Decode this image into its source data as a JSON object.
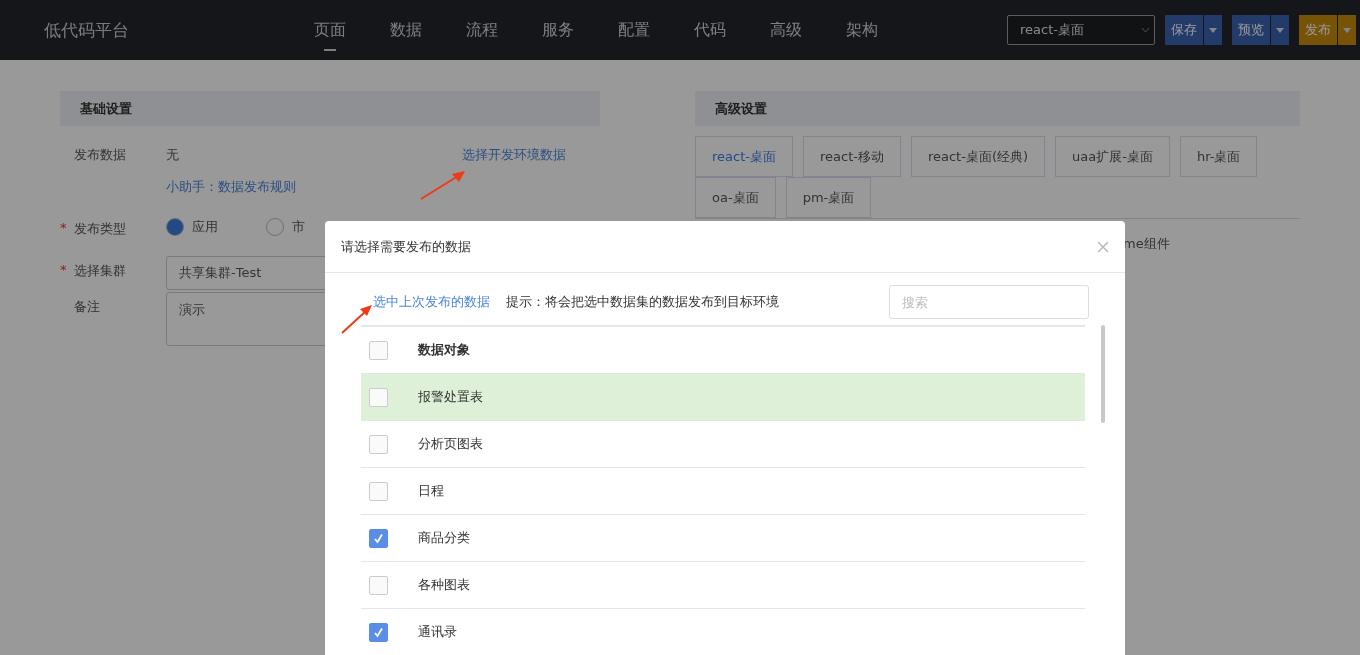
{
  "header": {
    "logo": "低代码平台",
    "nav": [
      {
        "label": "页面",
        "selected": true
      },
      {
        "label": "数据",
        "selected": false
      },
      {
        "label": "流程",
        "selected": false
      },
      {
        "label": "服务",
        "selected": false
      },
      {
        "label": "配置",
        "selected": false
      },
      {
        "label": "代码",
        "selected": false
      },
      {
        "label": "高级",
        "selected": false
      },
      {
        "label": "架构",
        "selected": false
      }
    ],
    "env_select": "react-桌面",
    "buttons": [
      {
        "label": "保存",
        "kind": "primary"
      },
      {
        "label": "预览",
        "kind": "primary"
      },
      {
        "label": "发布",
        "kind": "warning"
      }
    ]
  },
  "basic": {
    "title": "基础设置",
    "publish_data": {
      "label": "发布数据",
      "value": "无",
      "link": "选择开发环境数据",
      "help": "小助手：数据发布规则"
    },
    "publish_type": {
      "label": "发布类型",
      "required_mark": "*",
      "options": [
        {
          "label": "应用",
          "selected": true
        },
        {
          "label": "市",
          "selected": false
        }
      ]
    },
    "cluster": {
      "label": "选择集群",
      "required_mark": "*",
      "value": "共享集群-Test"
    },
    "remark": {
      "label": "备注",
      "value": "演示"
    }
  },
  "advanced": {
    "title": "高级设置",
    "tabs": [
      {
        "label": "react-桌面",
        "selected": true
      },
      {
        "label": "react-移动",
        "selected": false
      },
      {
        "label": "react-桌面(经典)",
        "selected": false
      },
      {
        "label": "uaa扩展-桌面",
        "selected": false
      },
      {
        "label": "hr-桌面",
        "selected": false
      },
      {
        "label": "oa-桌面",
        "selected": false
      },
      {
        "label": "pm-桌面",
        "selected": false
      }
    ],
    "option_text": "me组件"
  },
  "dialog": {
    "title": "请选择需要发布的数据",
    "link": "选中上次发布的数据",
    "hint": "提示：将会把选中数据集的数据发布到目标环境",
    "search": {
      "placeholder": "搜索"
    },
    "header": {
      "label": "数据对象",
      "checked": false
    },
    "rows": [
      {
        "name": "报警处置表",
        "checked": false,
        "selected": true
      },
      {
        "name": "分析页图表",
        "checked": false,
        "selected": false
      },
      {
        "name": "日程",
        "checked": false,
        "selected": false
      },
      {
        "name": "商品分类",
        "checked": true,
        "selected": false
      },
      {
        "name": "各种图表",
        "checked": false,
        "selected": false
      },
      {
        "name": "通讯录",
        "checked": true,
        "selected": false
      }
    ]
  }
}
